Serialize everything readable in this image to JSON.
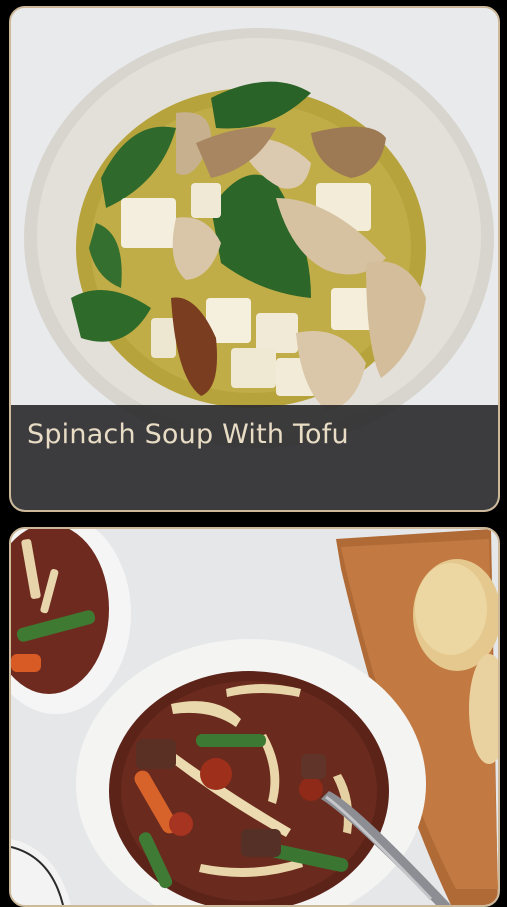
{
  "recipes": [
    {
      "title": "Spinach Soup With Tofu",
      "image": "spinach-soup-tofu-photo"
    },
    {
      "title": "",
      "image": "beef-noodle-soup-photo"
    }
  ],
  "colors": {
    "card_border": "#cdb99a",
    "overlay": "#2d2d2f",
    "title_text": "#e8dcc5",
    "background": "#000000"
  }
}
